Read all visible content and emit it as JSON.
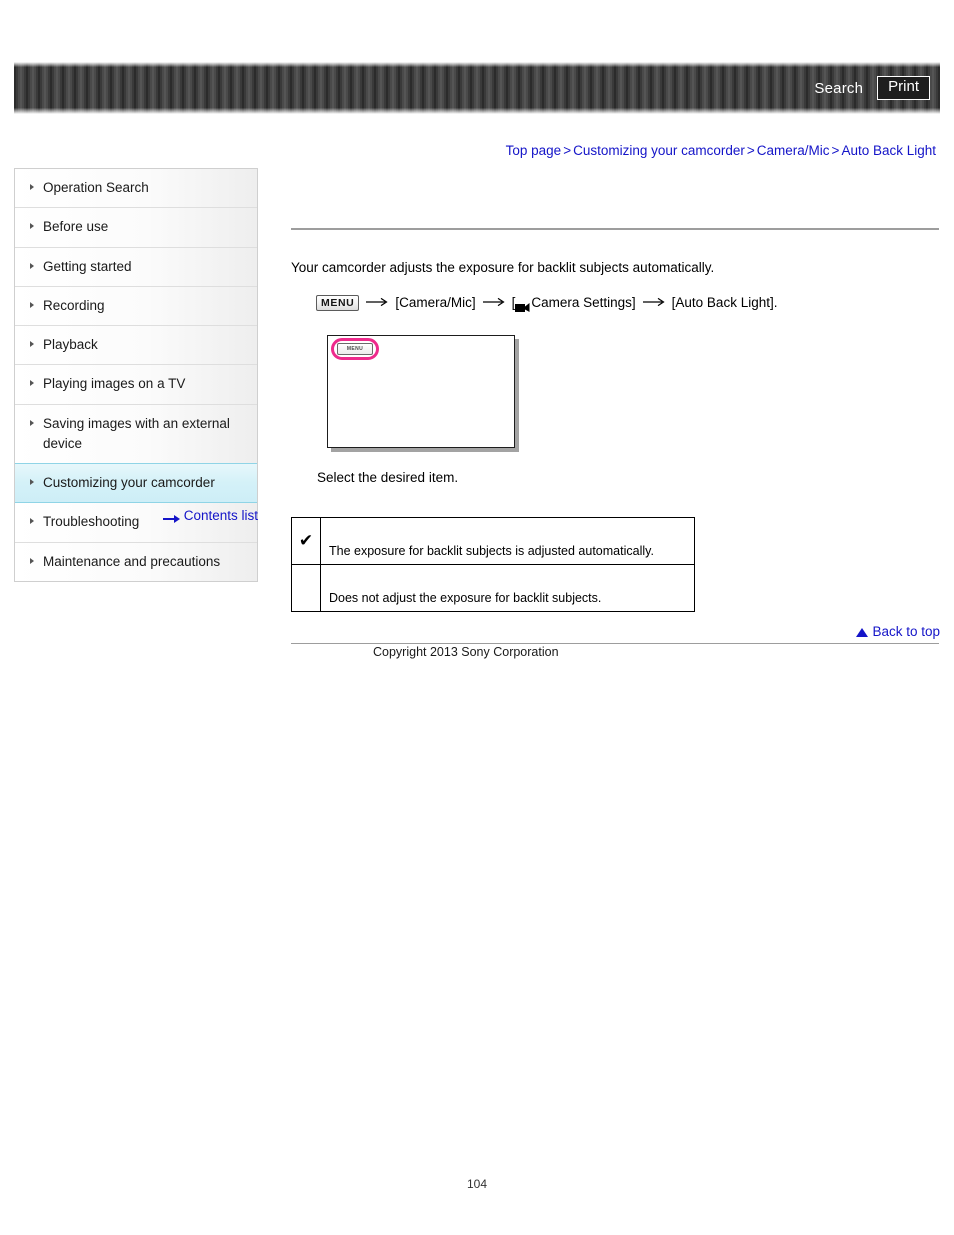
{
  "header": {
    "search_label": "Search",
    "print_label": "Print"
  },
  "breadcrumb": {
    "items": [
      {
        "label": "Top page"
      },
      {
        "label": "Customizing your camcorder"
      },
      {
        "label": "Camera/Mic"
      },
      {
        "label": "Auto Back Light"
      }
    ],
    "separator": ">"
  },
  "sidebar": {
    "items": [
      {
        "label": "Operation Search",
        "active": false
      },
      {
        "label": "Before use",
        "active": false
      },
      {
        "label": "Getting started",
        "active": false
      },
      {
        "label": "Recording",
        "active": false
      },
      {
        "label": "Playback",
        "active": false
      },
      {
        "label": "Playing images on a TV",
        "active": false
      },
      {
        "label": "Saving images with an external device",
        "active": false
      },
      {
        "label": "Customizing your camcorder",
        "active": true
      },
      {
        "label": "Troubleshooting",
        "active": false
      },
      {
        "label": "Maintenance and precautions",
        "active": false
      }
    ],
    "contents_list_label": "Contents list"
  },
  "main": {
    "intro": "Your camcorder adjusts the exposure for backlit subjects automatically.",
    "menu_path": {
      "menu_chip_label": "MENU",
      "arrow": "→",
      "step1": "[Camera/Mic]",
      "step2_open": "[",
      "step2_label": "Camera Settings]",
      "step3": "[Auto Back Light]."
    },
    "illustration": {
      "menu_button_label": "MENU",
      "highlight_color": "#ee2a8c"
    },
    "select_item_text": "Select the desired item.",
    "options_table": {
      "rows": [
        {
          "check": "✔",
          "description": "The exposure for backlit subjects is adjusted automatically."
        },
        {
          "check": "",
          "description": "Does not adjust the exposure for backlit subjects."
        }
      ]
    }
  },
  "footer": {
    "back_to_top_label": "Back to top",
    "copyright": "Copyright 2013 Sony Corporation",
    "page_number": "104"
  }
}
